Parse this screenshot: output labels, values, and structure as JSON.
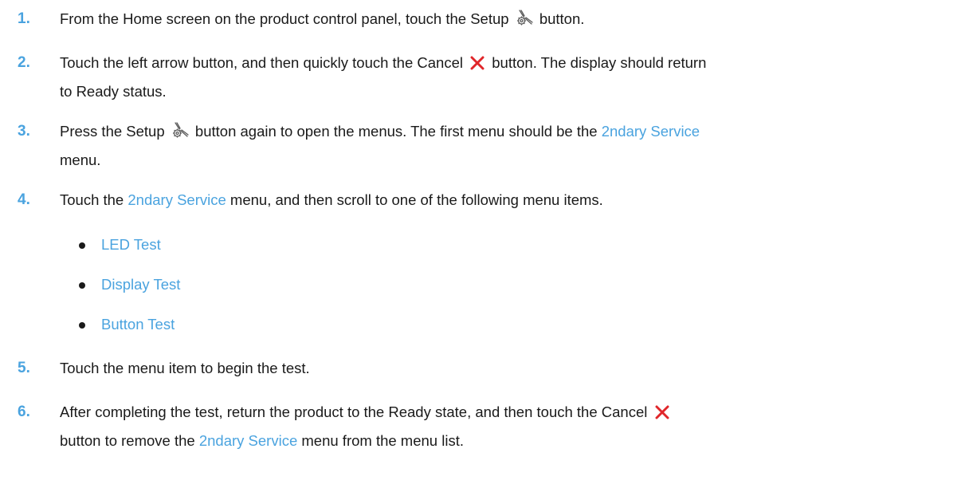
{
  "colors": {
    "accent": "#4aa3df",
    "text": "#1a1a1a",
    "cancel": "#e0262a",
    "icon": "#5a5a5a"
  },
  "steps": [
    {
      "number": "1.",
      "parts": {
        "a": "From the Home screen on the product control panel, touch the Setup",
        "b": "button."
      }
    },
    {
      "number": "2.",
      "parts": {
        "a": "Touch the left arrow button, and then quickly touch the Cancel",
        "b": "button. The display should return",
        "c": "to Ready status."
      }
    },
    {
      "number": "3.",
      "parts": {
        "a": "Press the Setup",
        "b": "button again to open the menus. The first menu should be the",
        "link": "2ndary Service",
        "c": "menu."
      }
    },
    {
      "number": "4.",
      "parts": {
        "a": "Touch the",
        "link": "2ndary Service",
        "b": "menu, and then scroll to one of the following menu items."
      }
    },
    {
      "number": "5.",
      "parts": {
        "a": "Touch the menu item to begin the test."
      }
    },
    {
      "number": "6.",
      "parts": {
        "a": "After completing the test, return the product to the Ready state, and then touch the Cancel",
        "b": "button to remove the",
        "link": "2ndary Service",
        "c": "menu from the menu list."
      }
    }
  ],
  "menu_items": [
    "LED Test",
    "Display Test",
    "Button Test"
  ],
  "icons": {
    "setup": "setup-wrench-icon",
    "cancel": "cancel-x-icon"
  }
}
